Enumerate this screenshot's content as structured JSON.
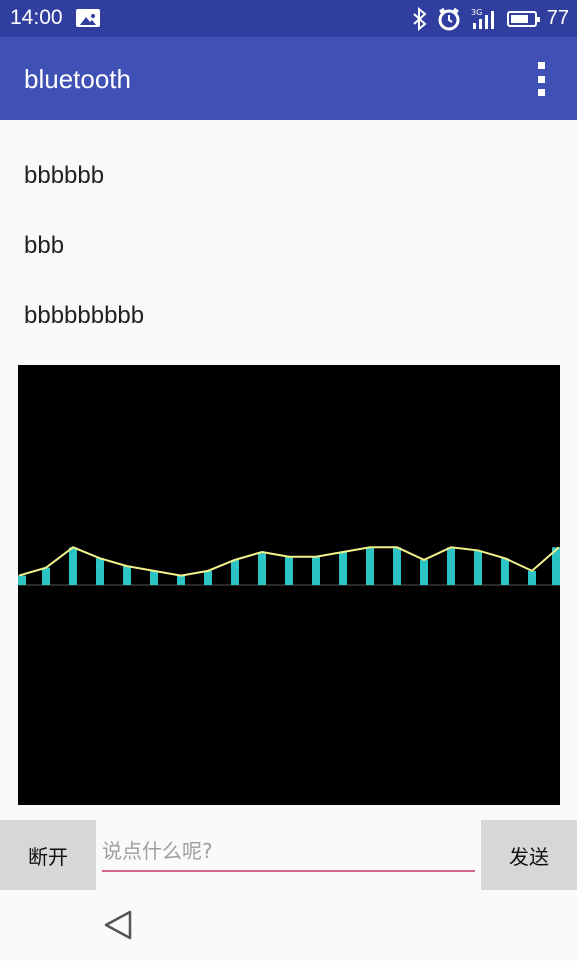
{
  "status_bar": {
    "time": "14:00",
    "icons": [
      "gallery-icon",
      "bluetooth-icon",
      "alarm-icon",
      "signal-3g-icon",
      "battery-icon"
    ],
    "network_label": "3G",
    "battery_level": 0.77,
    "battery_text": "77"
  },
  "app_bar": {
    "title": "bluetooth",
    "menu_icon": "overflow-menu-icon",
    "color": "#3f51b5"
  },
  "messages": [
    "bbbbbb",
    "bbb",
    "bbbbbbbbb"
  ],
  "chart_data": {
    "type": "bar",
    "series": [
      {
        "values": [
          0.3,
          0.55,
          1.2,
          0.85,
          0.6,
          0.45,
          0.3,
          0.45,
          0.8,
          1.05,
          0.9,
          0.9,
          1.05,
          1.2,
          1.2,
          0.8,
          1.2,
          1.1,
          0.85,
          0.45,
          1.2
        ]
      }
    ],
    "ylim": [
      -7,
      7
    ],
    "bar_color": "#2bc3c3",
    "line_color": "#f2f28c",
    "baseline_color": "#555555",
    "background": "#000000"
  },
  "input_row": {
    "disconnect_label": "断开",
    "placeholder": "说点什么呢?",
    "value": "",
    "send_label": "发送",
    "underline_color": "#d4628b"
  },
  "nav_bar": {
    "back_icon": "back-triangle-icon"
  }
}
